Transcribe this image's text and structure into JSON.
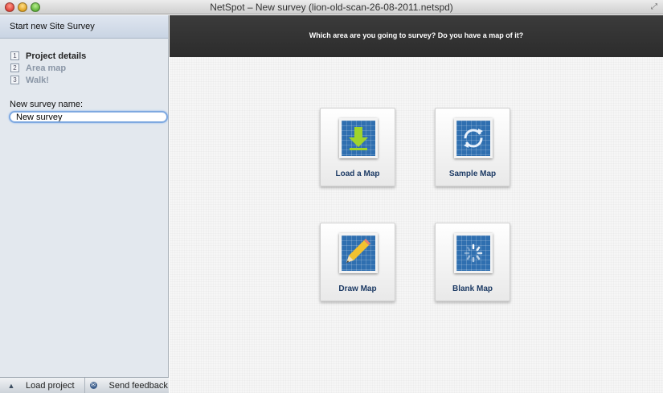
{
  "window": {
    "title": "NetSpot – New survey (lion-old-scan-26-08-2011.netspd)"
  },
  "sidebar": {
    "header": "Start new Site Survey",
    "steps": [
      {
        "num": "1",
        "label": "Project details",
        "active": true
      },
      {
        "num": "2",
        "label": "Area map",
        "active": false
      },
      {
        "num": "3",
        "label": "Walk!",
        "active": false
      }
    ],
    "name_label": "New survey name:",
    "name_value": "New survey",
    "footer": {
      "load_label": "Load project",
      "feedback_label": "Send feedback"
    }
  },
  "main": {
    "question": "Which area are you going to survey? Do you have a map of it?",
    "options": [
      {
        "label": "Load a Map",
        "icon": "download-arrow-icon"
      },
      {
        "label": "Sample Map",
        "icon": "refresh-icon"
      },
      {
        "label": "Draw Map",
        "icon": "pencil-icon"
      },
      {
        "label": "Blank Map",
        "icon": "spinner-icon"
      }
    ]
  },
  "colors": {
    "accent": "#2f6fb0",
    "tile_label": "#1c3a64",
    "header_bg": "#333333"
  }
}
